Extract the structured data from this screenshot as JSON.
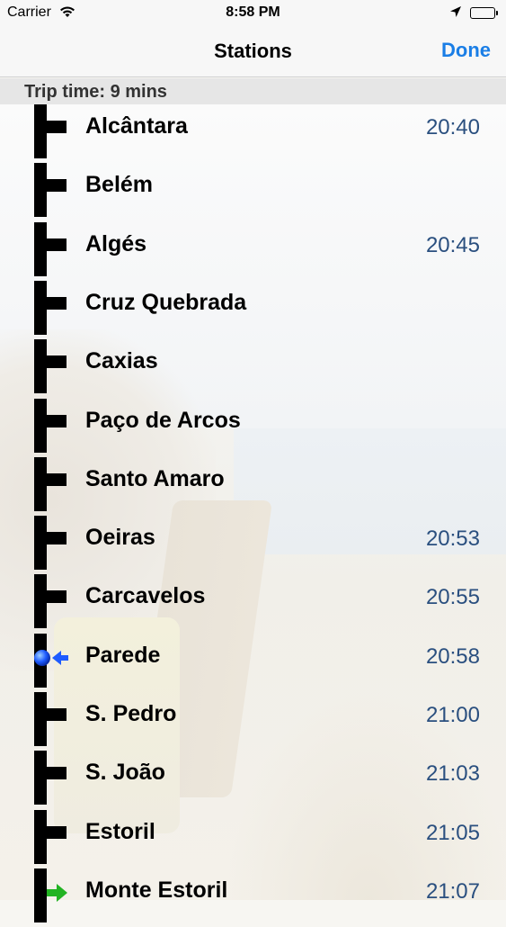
{
  "status_bar": {
    "carrier": "Carrier",
    "time": "8:58 PM"
  },
  "nav": {
    "title": "Stations",
    "done_label": "Done"
  },
  "section": {
    "trip_time": "Trip time: 9 mins"
  },
  "colors": {
    "accent": "#1a7ee6",
    "time_text": "#2a4f7f",
    "current_marker": "#1e5bff",
    "destination_marker": "#22b322"
  },
  "stations": [
    {
      "name": "Alcântara",
      "time": "20:40",
      "marker": "stop"
    },
    {
      "name": "Belém",
      "time": "",
      "marker": "stop"
    },
    {
      "name": "Algés",
      "time": "20:45",
      "marker": "stop"
    },
    {
      "name": "Cruz Quebrada",
      "time": "",
      "marker": "stop"
    },
    {
      "name": "Caxias",
      "time": "",
      "marker": "stop"
    },
    {
      "name": "Paço de Arcos",
      "time": "",
      "marker": "stop"
    },
    {
      "name": "Santo Amaro",
      "time": "",
      "marker": "stop"
    },
    {
      "name": "Oeiras",
      "time": "20:53",
      "marker": "stop"
    },
    {
      "name": "Carcavelos",
      "time": "20:55",
      "marker": "stop"
    },
    {
      "name": "Parede",
      "time": "20:58",
      "marker": "current"
    },
    {
      "name": "S. Pedro",
      "time": "21:00",
      "marker": "stop"
    },
    {
      "name": "S. João",
      "time": "21:03",
      "marker": "stop"
    },
    {
      "name": "Estoril",
      "time": "21:05",
      "marker": "stop"
    },
    {
      "name": "Monte Estoril",
      "time": "21:07",
      "marker": "destination"
    }
  ]
}
